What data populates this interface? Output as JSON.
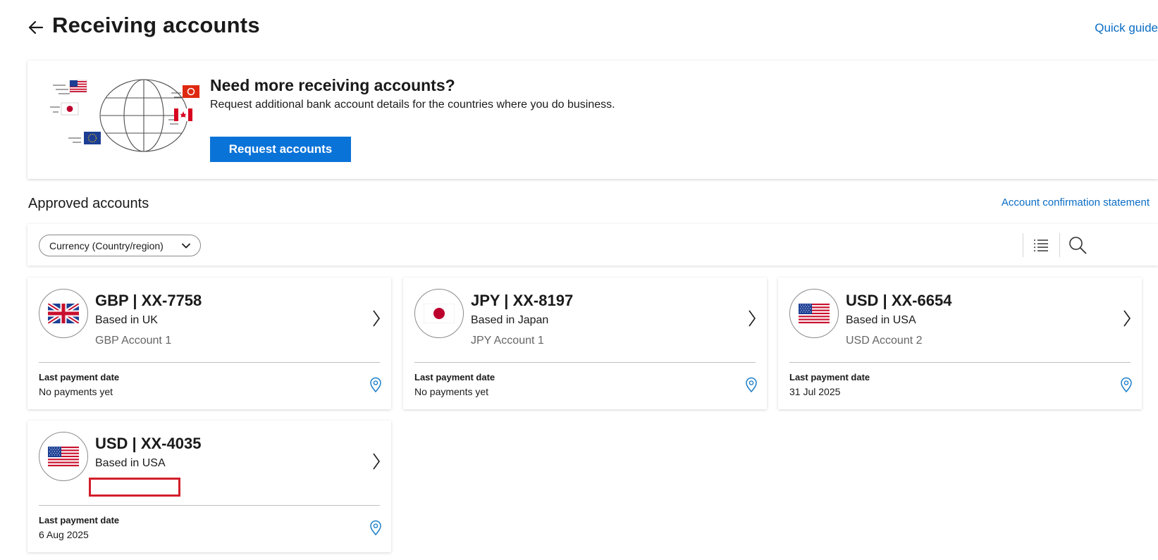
{
  "header": {
    "back_icon": "arrow-left-icon",
    "title": "Receiving accounts",
    "quick_guide": "Quick guide"
  },
  "promo": {
    "title": "Need more receiving accounts?",
    "description": "Request additional bank account details for the countries where you do business.",
    "button_label": "Request accounts",
    "illustration_icon": "globe-flags-illustration"
  },
  "approved": {
    "title": "Approved accounts",
    "confirmation_link": "Account confirmation statement",
    "filter_label": "Currency (Country/region)",
    "filter_icon": "chevron-down-icon",
    "list_view_icon": "list-view-icon",
    "search_icon": "search-icon"
  },
  "accounts": [
    {
      "currency": "GBP",
      "number": "XX-7758",
      "title": "GBP | XX-7758",
      "based": "Based in UK",
      "nickname": "GBP Account 1",
      "pay_label": "Last payment date",
      "pay_value": "No payments yet",
      "flag": "uk-flag-icon"
    },
    {
      "currency": "JPY",
      "number": "XX-8197",
      "title": "JPY | XX-8197",
      "based": "Based in Japan",
      "nickname": "JPY Account 1",
      "pay_label": "Last payment date",
      "pay_value": "No payments yet",
      "flag": "japan-flag-icon"
    },
    {
      "currency": "USD",
      "number": "XX-6654",
      "title": "USD | XX-6654",
      "based": "Based in USA",
      "nickname": "USD Account 2",
      "pay_label": "Last payment date",
      "pay_value": "31 Jul 2025",
      "flag": "usa-flag-icon"
    },
    {
      "currency": "USD",
      "number": "XX-4035",
      "title": "USD | XX-4035",
      "based": "Based in USA",
      "nickname": "",
      "pay_label": "Last payment date",
      "pay_value": "6 Aug 2025",
      "flag": "usa-flag-icon"
    }
  ],
  "colors": {
    "link": "#0a6cc4",
    "primary_button": "#0a73d8",
    "redaction_box": "#d21f2b"
  }
}
